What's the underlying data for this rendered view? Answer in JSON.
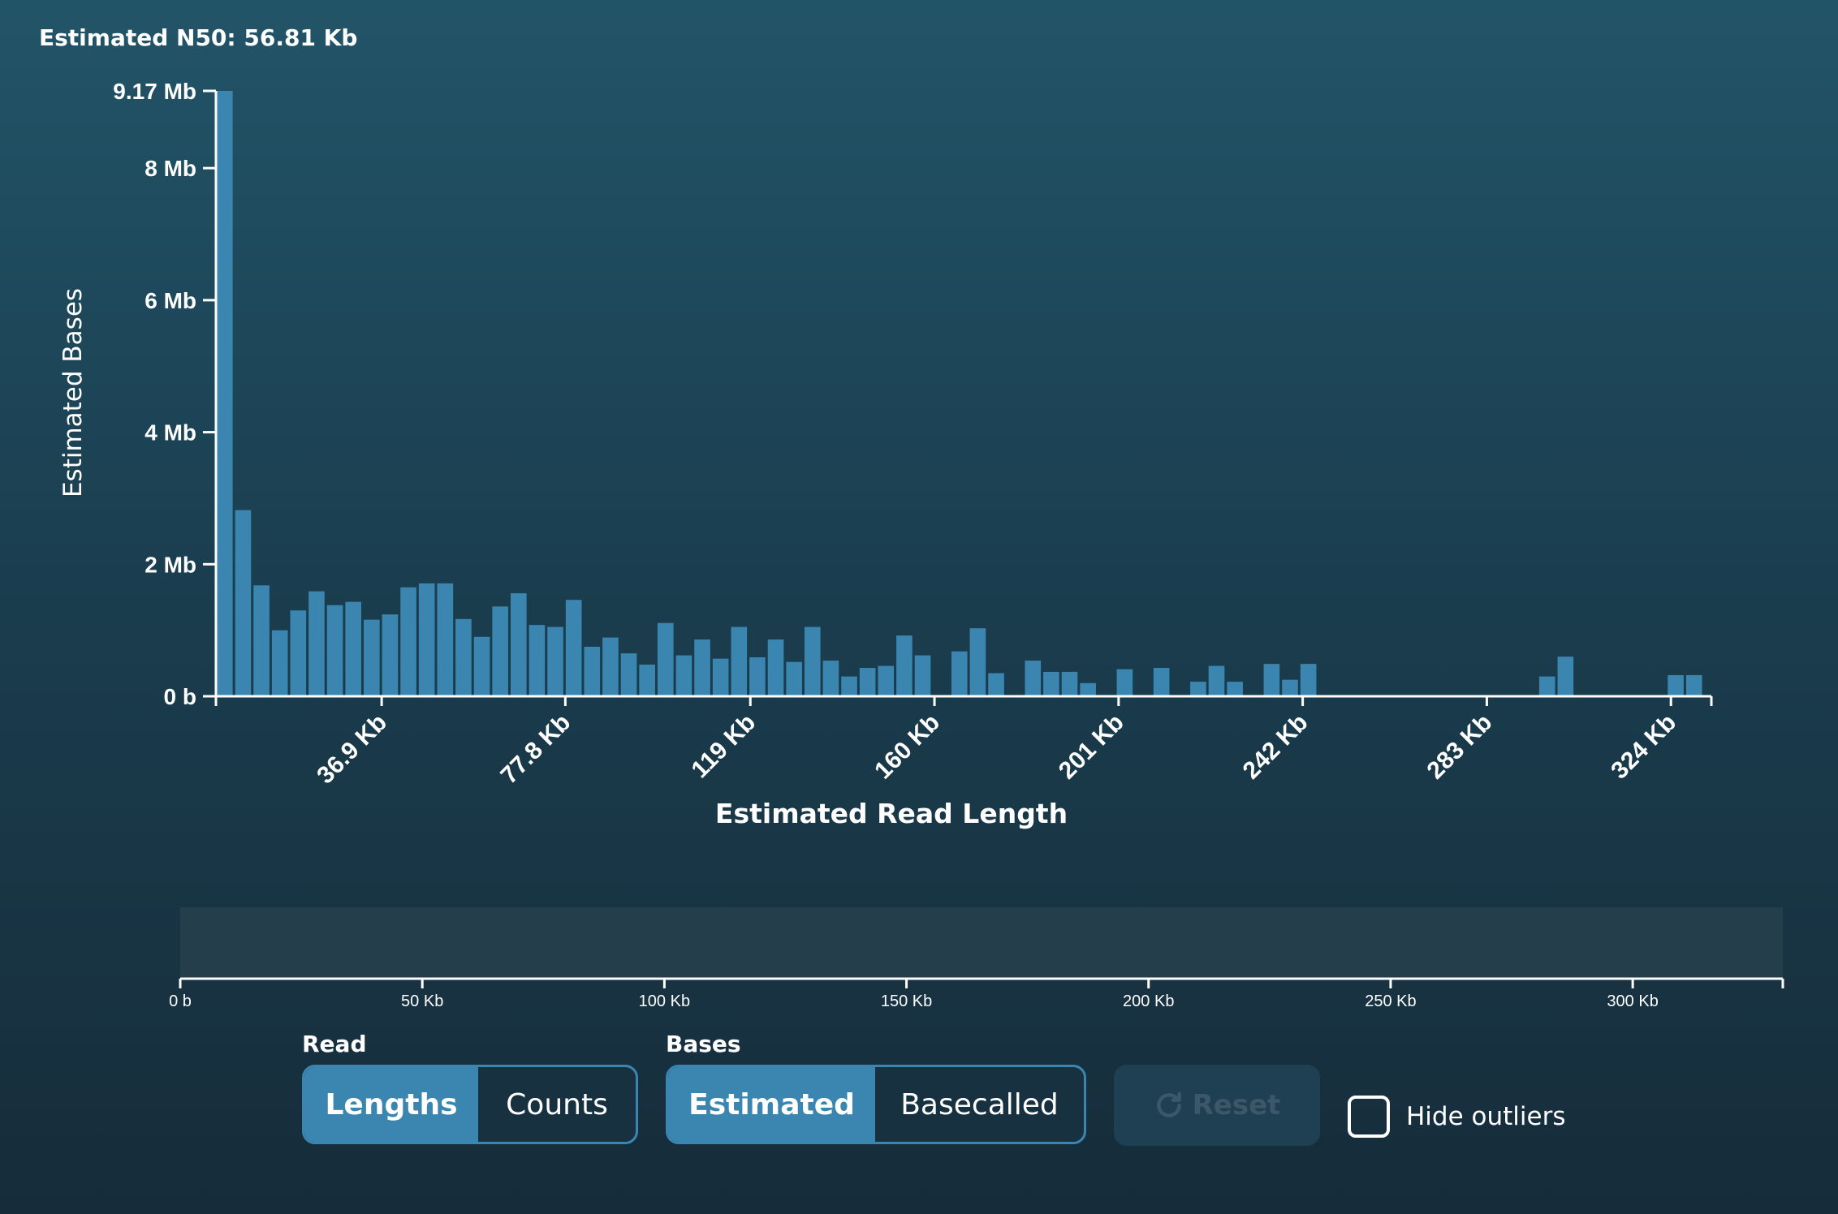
{
  "header": {
    "n50_text": "Estimated N50: 56.81 Kb"
  },
  "colors": {
    "bar": "#3a86b0",
    "axis": "#ffffff",
    "brush_bg": "#243e4c",
    "accent": "#3a86b0"
  },
  "chart_data": {
    "type": "bar",
    "xlabel": "Estimated Read Length",
    "ylabel": "Estimated Bases",
    "y_tick_labels": [
      "0 b",
      "2 Mb",
      "4 Mb",
      "6 Mb",
      "8 Mb",
      "9.17 Mb"
    ],
    "y_tick_values": [
      0,
      2,
      4,
      6,
      8,
      9.17
    ],
    "y_unit": "Mb",
    "ylim": [
      0,
      9.17
    ],
    "x_tick_labels": [
      "36.9 Kb",
      "77.8 Kb",
      "119 Kb",
      "160 Kb",
      "201 Kb",
      "242 Kb",
      "283 Kb",
      "324 Kb"
    ],
    "x_tick_values": [
      36.9,
      77.8,
      119,
      160,
      201,
      242,
      283,
      324
    ],
    "xlim": [
      0,
      333
    ],
    "bin_width_kb": 4.09,
    "values": [
      9.17,
      2.82,
      1.68,
      1.0,
      1.3,
      1.59,
      1.38,
      1.43,
      1.16,
      1.24,
      1.65,
      1.71,
      1.71,
      1.17,
      0.9,
      1.36,
      1.56,
      1.08,
      1.05,
      1.46,
      0.75,
      0.89,
      0.65,
      0.48,
      1.11,
      0.62,
      0.86,
      0.57,
      1.05,
      0.59,
      0.86,
      0.52,
      1.05,
      0.54,
      0.3,
      0.43,
      0.46,
      0.92,
      0.62,
      0,
      0.68,
      1.03,
      0.35,
      0,
      0.54,
      0.37,
      0.37,
      0.2,
      0,
      0.41,
      0,
      0.43,
      0,
      0.22,
      0.46,
      0.22,
      0,
      0.49,
      0.25,
      0.49,
      0,
      0,
      0,
      0,
      0,
      0,
      0,
      0,
      0,
      0,
      0,
      0,
      0,
      0,
      0,
      0,
      0,
      0,
      0,
      0,
      0,
      0,
      0,
      0,
      0,
      0,
      0,
      0,
      0,
      0,
      0,
      0,
      0,
      0,
      0,
      0,
      0,
      0,
      0,
      0,
      0,
      0,
      0,
      0,
      0,
      0,
      0,
      0,
      0,
      0,
      0,
      0,
      0,
      0,
      0,
      0,
      0,
      0,
      0,
      0,
      0,
      0,
      0,
      0,
      0,
      0,
      0,
      0,
      0,
      0,
      0,
      0,
      0,
      0,
      0,
      0,
      0,
      0,
      0,
      0,
      0,
      0,
      0,
      0,
      0,
      0,
      0,
      0,
      0,
      0,
      0,
      0,
      0,
      0,
      0,
      0,
      0,
      0,
      0,
      0,
      0,
      0,
      0,
      0,
      0,
      0,
      0,
      0,
      0,
      0,
      0,
      0,
      0,
      0,
      0,
      0,
      0,
      0,
      0,
      0
    ],
    "bins": [
      {
        "x": 0,
        "y": 9.17
      },
      {
        "x": 4.09,
        "y": 2.82
      },
      {
        "x": 8.18,
        "y": 1.68
      },
      {
        "x": 12.27,
        "y": 1.0
      },
      {
        "x": 16.36,
        "y": 1.3
      },
      {
        "x": 20.45,
        "y": 1.59
      },
      {
        "x": 24.54,
        "y": 1.38
      },
      {
        "x": 28.63,
        "y": 1.43
      },
      {
        "x": 32.72,
        "y": 1.16
      },
      {
        "x": 36.81,
        "y": 1.24
      },
      {
        "x": 40.9,
        "y": 1.65
      },
      {
        "x": 44.99,
        "y": 1.71
      },
      {
        "x": 49.08,
        "y": 1.71
      },
      {
        "x": 53.17,
        "y": 1.17
      },
      {
        "x": 57.26,
        "y": 0.9
      },
      {
        "x": 61.35,
        "y": 1.36
      },
      {
        "x": 65.44,
        "y": 1.56
      },
      {
        "x": 69.53,
        "y": 1.08
      },
      {
        "x": 73.62,
        "y": 1.05
      },
      {
        "x": 77.71,
        "y": 1.46
      },
      {
        "x": 81.8,
        "y": 0.75
      },
      {
        "x": 85.89,
        "y": 0.89
      },
      {
        "x": 89.98,
        "y": 0.65
      },
      {
        "x": 94.07,
        "y": 0.48
      },
      {
        "x": 98.16,
        "y": 1.11
      },
      {
        "x": 102.25,
        "y": 0.62
      },
      {
        "x": 106.34,
        "y": 0.86
      },
      {
        "x": 110.43,
        "y": 0.57
      },
      {
        "x": 114.52,
        "y": 1.05
      },
      {
        "x": 118.61,
        "y": 0.59
      },
      {
        "x": 122.7,
        "y": 0.86
      },
      {
        "x": 126.79,
        "y": 0.52
      },
      {
        "x": 130.88,
        "y": 1.05
      },
      {
        "x": 134.97,
        "y": 0.54
      },
      {
        "x": 139.06,
        "y": 0.3
      },
      {
        "x": 143.15,
        "y": 0.43
      },
      {
        "x": 147.24,
        "y": 0.46
      },
      {
        "x": 151.33,
        "y": 0.92
      },
      {
        "x": 155.42,
        "y": 0.62
      },
      {
        "x": 163.6,
        "y": 0.68
      },
      {
        "x": 167.69,
        "y": 1.03
      },
      {
        "x": 171.78,
        "y": 0.35
      },
      {
        "x": 179.96,
        "y": 0.54
      },
      {
        "x": 184.05,
        "y": 0.37
      },
      {
        "x": 188.14,
        "y": 0.37
      },
      {
        "x": 192.23,
        "y": 0.2
      },
      {
        "x": 200.41,
        "y": 0.41
      },
      {
        "x": 208.59,
        "y": 0.43
      },
      {
        "x": 216.77,
        "y": 0.22
      },
      {
        "x": 220.86,
        "y": 0.46
      },
      {
        "x": 224.95,
        "y": 0.22
      },
      {
        "x": 233.13,
        "y": 0.49
      },
      {
        "x": 237.22,
        "y": 0.25
      },
      {
        "x": 241.31,
        "y": 0.49
      },
      {
        "x": 294.48,
        "y": 0.3
      },
      {
        "x": 298.57,
        "y": 0.6
      },
      {
        "x": 323.11,
        "y": 0.32
      },
      {
        "x": 327.2,
        "y": 0.32
      }
    ]
  },
  "brush": {
    "tick_labels": [
      "0 b",
      "50 Kb",
      "100 Kb",
      "150 Kb",
      "200 Kb",
      "250 Kb",
      "300 Kb"
    ],
    "tick_values": [
      0,
      50,
      100,
      150,
      200,
      250,
      300
    ],
    "max_kb": 331
  },
  "controls": {
    "read_label": "Read",
    "read_options": [
      "Lengths",
      "Counts"
    ],
    "read_selected": "Lengths",
    "bases_label": "Bases",
    "bases_options": [
      "Estimated",
      "Basecalled"
    ],
    "bases_selected": "Estimated",
    "reset_label": "Reset",
    "hide_outliers_label": "Hide outliers",
    "hide_outliers_checked": false
  }
}
